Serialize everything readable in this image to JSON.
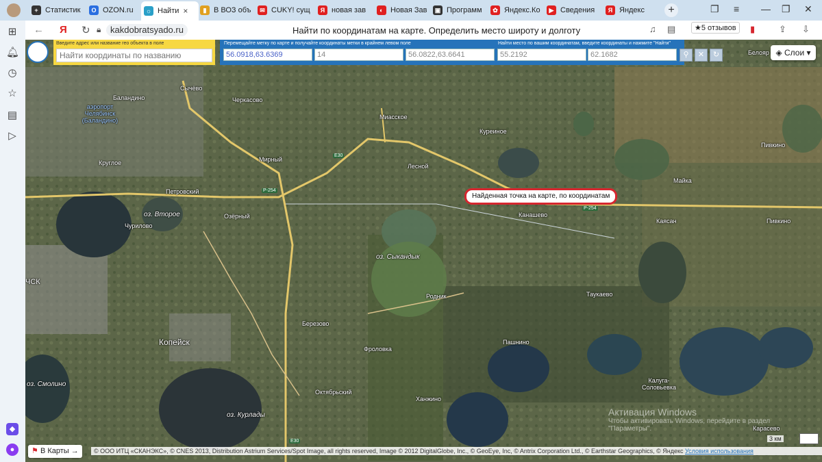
{
  "browser": {
    "tabs": [
      {
        "label": "Статистик",
        "color": "#333333",
        "glyph": "+"
      },
      {
        "label": "OZON.ru",
        "color": "#2a6ee0",
        "glyph": "O"
      },
      {
        "label": "Найти",
        "color": "#2aa0c8",
        "glyph": "☼"
      },
      {
        "label": "В ВОЗ объ",
        "color": "#e0a020",
        "glyph": "▮"
      },
      {
        "label": "CUKY! сущ",
        "color": "#e02020",
        "glyph": "✉"
      },
      {
        "label": "новая зав",
        "color": "#e02020",
        "glyph": "Я"
      },
      {
        "label": "Новая Зав",
        "color": "#e02020",
        "glyph": "◐"
      },
      {
        "label": "Программ",
        "color": "#333333",
        "glyph": "▣"
      },
      {
        "label": "Яндекс.Ко",
        "color": "#e02020",
        "glyph": "✿"
      },
      {
        "label": "Сведения",
        "color": "#e02020",
        "glyph": "▶"
      },
      {
        "label": "Яндекс",
        "color": "#e02020",
        "glyph": "Я"
      }
    ],
    "active_tab_close": "×",
    "new_tab": "+",
    "url": "kakdobratsyado.ru",
    "page_title": "Найти по координатам на карте. Определить место широту и долготу",
    "reviews": "★5 отзывов",
    "back": "←",
    "yandex_glyph": "Я",
    "reload": "↻"
  },
  "search": {
    "caption": "Введите адрес или название гео объекта в поле",
    "placeholder": "Найти координаты по названию"
  },
  "coords_panel": {
    "caption_left": "Перемещайте метку по карте и получайте координаты метки в крайнем левом поле",
    "caption_right": "Найти место по вашим координатам, введите координаты и нажмите \"Найти\"",
    "marker_coords": "56.0918,63.6369",
    "zoom": "14",
    "corner_coords": "56.0822,63.6641",
    "lat_input": "55.2192",
    "lon_input": "62.1682",
    "find_icon": "search-icon",
    "clear_icon": "close-icon",
    "refresh_icon": "refresh-icon"
  },
  "map": {
    "layers_button": "Слои",
    "balloon": "Найденная точка на карте, по координатам",
    "to_maps": "В Карты →",
    "scale": "3 км",
    "copyright": "© ООО ИТЦ «СКАНЭКС», © CNES 2013, Distribution Astrium Services/Spot Image, all rights reserved, Image © 2012 DigitalGlobe, Inc., © GeoEye, Inc, © Antrix Corporation Ltd., © Earthstar Geographics, © Яндекс",
    "terms": "Условия использования",
    "watermark_title": "Активация Windows",
    "watermark_text": "Чтобы активировать Windows, перейдите в раздел",
    "watermark_text2": "\"Параметры\".",
    "places": {
      "balandino": "Баландино",
      "airport": "аэропорт Челябинск (Баландино)",
      "sychevo": "Сычёво",
      "cherkasovo": "Черкасово",
      "miasskoe": "Миасское",
      "kureinoe": "Куреиное",
      "kruglo": "Круглое",
      "mirny": "Мирный",
      "lesnoy": "Лесной",
      "petrovsky": "Петровский",
      "vtoroe": "оз. Второе",
      "ozerny": "Озёрный",
      "churilovo": "Чурилово",
      "mayka": "Майка",
      "kanashevo": "Канашево",
      "kayasan": "Каясан",
      "pivkino1": "Пивкино",
      "pivkino2": "Пивкино",
      "belo": "Белояр",
      "syankdyk": "оз. Сыкандык",
      "rodnik": "Родник",
      "taukaevo": "Таукаево",
      "berezovo": "Березово",
      "kopeysk": "Копейск",
      "frolovka": "Фроловка",
      "pashnino": "Пашнино",
      "kaluga": "Калуга-Соловьевка",
      "smolino": "оз. Смолино",
      "oktyabrsky": "Октябрьский",
      "khanzhino": "Ханжино",
      "kurlady": "оз. Курлады",
      "karasevo": "Карасево",
      "chsk": "ЧСК"
    },
    "roads": {
      "e30a": "E30",
      "p254a": "Р-254",
      "p254b": "Р-254",
      "e30b": "E30"
    }
  }
}
